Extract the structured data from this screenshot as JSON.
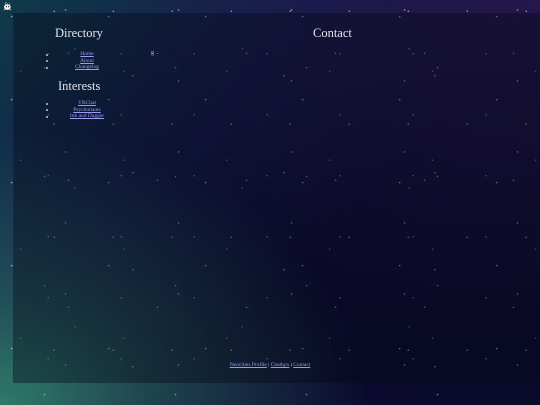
{
  "header": {
    "icon": "bunny-icon"
  },
  "directory": {
    "heading": "Directory",
    "items": [
      {
        "label": "Home"
      },
      {
        "label": "About"
      },
      {
        "label": "Changelog"
      }
    ]
  },
  "contact": {
    "heading": "Contact"
  },
  "interests": {
    "heading": "Interests",
    "items": [
      {
        "label": "VRChat"
      },
      {
        "label": "Psychonauts"
      },
      {
        "label": "Ink and Dagger"
      }
    ]
  },
  "stray": {
    "text": "g"
  },
  "footer": {
    "links": [
      {
        "label": "Neocities Profile"
      },
      {
        "label": "Chatbox"
      },
      {
        "label": "Contact"
      }
    ],
    "separator": "|"
  },
  "colors": {
    "link": "#9c9cf0",
    "text": "#e6e6f0"
  }
}
